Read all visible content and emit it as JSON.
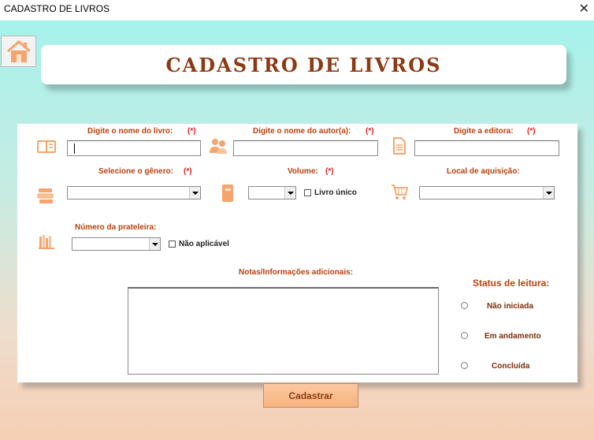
{
  "window": {
    "title": "CADASTRO DE LIVROS",
    "close_glyph": "✕"
  },
  "header": {
    "title": "CADASTRO DE LIVROS",
    "home_icon": "home-icon"
  },
  "form": {
    "book_name": {
      "label": "Digite o nome do livro:",
      "required": "(*)",
      "value": ""
    },
    "author_name": {
      "label": "Digite o nome do autor(a):",
      "required": "(*)",
      "value": ""
    },
    "publisher": {
      "label": "Digite a editora:",
      "required": "(*)",
      "value": ""
    },
    "genre": {
      "label": "Selecione o gênero:",
      "required": "(*)",
      "value": ""
    },
    "volume": {
      "label": "Volume:",
      "required": "(*)",
      "value": "",
      "single_book_label": "Livro único"
    },
    "acquisition_place": {
      "label": "Local de aquisição:",
      "value": ""
    },
    "shelf_number": {
      "label": "Número da prateleira:",
      "value": "",
      "not_applicable_label": "Não aplicável"
    },
    "notes": {
      "label": "Notas/Informações adicionais:",
      "value": ""
    }
  },
  "reading_status": {
    "title": "Status de leitura:",
    "options": [
      "Não iniciada",
      "Em andamento",
      "Concluída"
    ]
  },
  "actions": {
    "submit_label": "Cadastrar"
  },
  "icons": [
    "book-icon",
    "authors-icon",
    "document-icon",
    "books-stack-icon",
    "notebook-icon",
    "shopping-cart-icon",
    "bookshelf-icon"
  ],
  "colors": {
    "accent": "#f4a46c",
    "label": "#b8400e",
    "required": "#e21d1d",
    "title": "#8b3a14"
  }
}
